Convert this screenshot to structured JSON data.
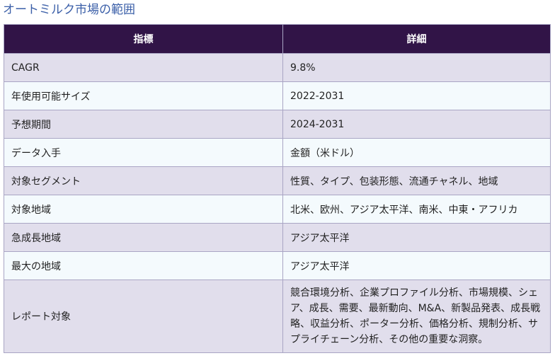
{
  "title": "オートミルク市場の範囲",
  "table": {
    "headers": [
      "指標",
      "詳細"
    ],
    "rows": [
      {
        "label": "CAGR",
        "value": "9.8%"
      },
      {
        "label": "年使用可能サイズ",
        "value": "2022-2031"
      },
      {
        "label": "予想期間",
        "value": "2024-2031"
      },
      {
        "label": "データ入手",
        "value": "金額（米ドル）"
      },
      {
        "label": "対象セグメント",
        "value": "性質、タイプ、包装形態、流通チャネル、地域"
      },
      {
        "label": "対象地域",
        "value": "北米、欧州、アジア太平洋、南米、中東・アフリカ"
      },
      {
        "label": "急成長地域",
        "value": "アジア太平洋"
      },
      {
        "label": "最大の地域",
        "value": "アジア太平洋"
      },
      {
        "label": "レポート対象",
        "value": "競合環境分析、企業プロファイル分析、市場規模、シェア、成長、需要、最新動向、M&A、新製品発表、成長戦略、収益分析、ポーター分析、価格分析、規制分析、サプライチェーン分析、その他の重要な洞察。"
      }
    ]
  }
}
